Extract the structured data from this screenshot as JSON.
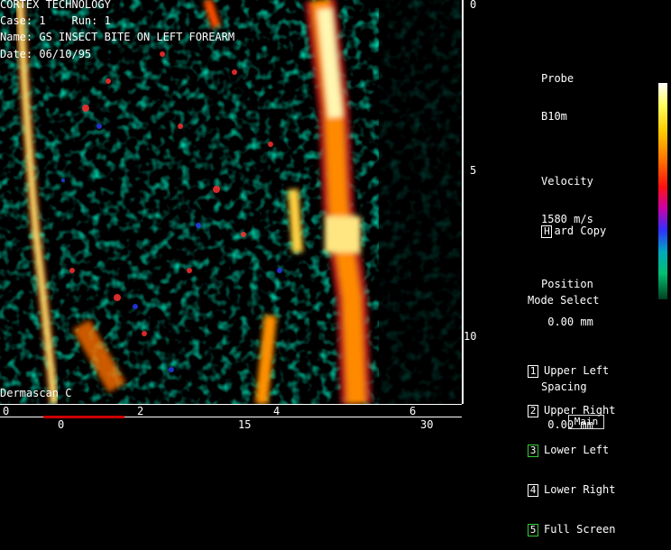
{
  "header": {
    "company": "CORTEX TECHNOLOGY",
    "case_line": "Case: 1    Run: 1",
    "name_line": "Name: GS INSECT BITE ON LEFT FOREARM",
    "date_line": "Date: 06/10/95"
  },
  "device_label": "Dermascan C",
  "scale": {
    "right_depth_labels": [
      "0",
      "5",
      "10"
    ],
    "bottom_mm_labels": [
      "0",
      "2",
      "4",
      "6"
    ],
    "bottom_time_labels": [
      "0",
      "15",
      "30"
    ]
  },
  "probe": {
    "probe_label": "Probe",
    "probe_value": "B10m",
    "velocity_label": "Velocity",
    "velocity_value": "1580 m/s",
    "position_label": "Position",
    "position_value": " 0.00 mm",
    "spacing_label": "Spacing",
    "spacing_value": " 0.00 mm"
  },
  "hard_copy": {
    "key": "H",
    "label": "ard Copy"
  },
  "mode_select": {
    "title": "Mode Select",
    "items": [
      {
        "key": "1",
        "label": "Upper Left"
      },
      {
        "key": "2",
        "label": "Upper Right"
      },
      {
        "key": "3",
        "label": "Lower Left"
      },
      {
        "key": "4",
        "label": "Lower Right"
      },
      {
        "key": "5",
        "label": "Full Screen"
      }
    ]
  },
  "main_button": "Main",
  "colors": {
    "scan_bg": "#000000",
    "green_key": "#33cc33",
    "accent_red": "#cc0000"
  }
}
